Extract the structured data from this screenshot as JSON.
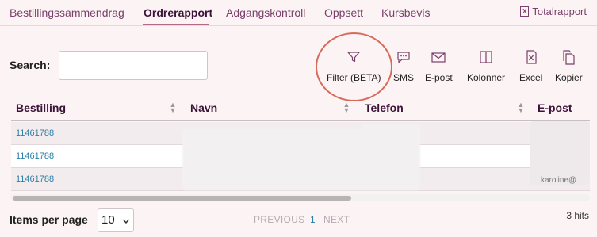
{
  "tabs": [
    {
      "label": "Bestillingssammendrag"
    },
    {
      "label": "Ordrerapport"
    },
    {
      "label": "Adgangskontroll"
    },
    {
      "label": "Oppsett"
    },
    {
      "label": "Kursbevis"
    }
  ],
  "active_tab": "Ordrerapport",
  "total_report": {
    "label": "Totalrapport",
    "icon": "excel-icon"
  },
  "search": {
    "label": "Search:",
    "value": "",
    "placeholder": ""
  },
  "toolbar": [
    {
      "label": "Filter (BETA)",
      "icon": "filter-icon"
    },
    {
      "label": "SMS",
      "icon": "chat-bubble-icon"
    },
    {
      "label": "E-post",
      "icon": "envelope-icon"
    },
    {
      "label": "Kolonner",
      "icon": "columns-icon"
    },
    {
      "label": "Excel",
      "icon": "excel-icon"
    },
    {
      "label": "Kopier",
      "icon": "copy-icon"
    }
  ],
  "table": {
    "columns": [
      "Bestilling",
      "Navn",
      "Telefon",
      "E-post"
    ],
    "rows": [
      {
        "bestilling": "11461788"
      },
      {
        "bestilling": "11461788"
      },
      {
        "bestilling": "11461788"
      }
    ],
    "partial_email": "karoline@"
  },
  "footer": {
    "items_per_page_label": "Items per page",
    "items_per_page_value": "10",
    "previous": "PREVIOUS",
    "page": "1",
    "next": "NEXT",
    "hits": "3 hits"
  },
  "colors": {
    "accent": "#7a3f6a",
    "highlight": "#d86a5c",
    "link": "#2b7fa6"
  }
}
